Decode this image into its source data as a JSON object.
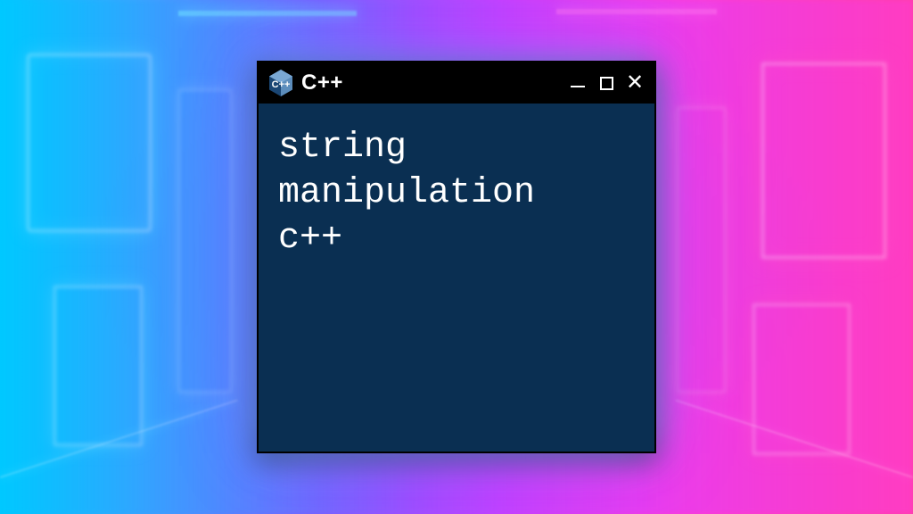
{
  "window": {
    "title": "C++",
    "icon_name": "cpp-hexagon-icon",
    "content": "string\nmanipulation\nc++"
  },
  "colors": {
    "window_bg": "#0a2f52",
    "titlebar_bg": "#000000",
    "text": "#ffffff",
    "icon_primary": "#5c8dbc",
    "icon_dark": "#1a4674"
  }
}
